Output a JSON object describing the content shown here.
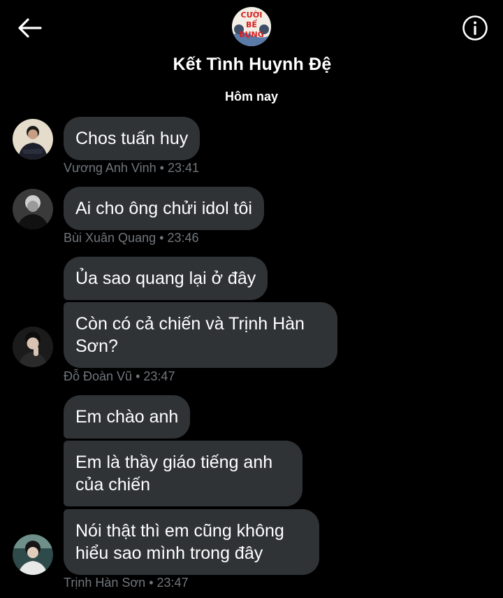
{
  "header": {
    "group_title": "Kết Tình Huynh Đệ",
    "group_logo_lines": [
      "CƯỜI",
      "BỂ",
      "BỤNG"
    ],
    "date_separator": "Hôm nay"
  },
  "messages": [
    {
      "text": "Chos tuấn huy",
      "sender": "Vương Anh Vinh",
      "time": "23:41"
    },
    {
      "text": "Ai cho ông chửi idol tôi",
      "sender": "Bùi Xuân Quang",
      "time": "23:46"
    },
    {
      "text_1": "Ủa sao quang lại ở đây",
      "text_2": "Còn có cả chiến và Trịnh Hàn Sơn?",
      "sender": "Đỗ Đoàn Vũ",
      "time": "23:47"
    },
    {
      "text_1": "Em chào anh",
      "text_2": "Em là thầy giáo tiếng anh của chiến",
      "text_3": "Nói thật thì em cũng không hiểu sao mình trong đây",
      "sender": "Trịnh Hàn Sơn",
      "time": "23:47"
    }
  ],
  "meta_separator": "•",
  "colors": {
    "background": "#000000",
    "bubble": "#2f3336",
    "meta_text": "#71767b",
    "logo_red": "#d81f1f"
  }
}
